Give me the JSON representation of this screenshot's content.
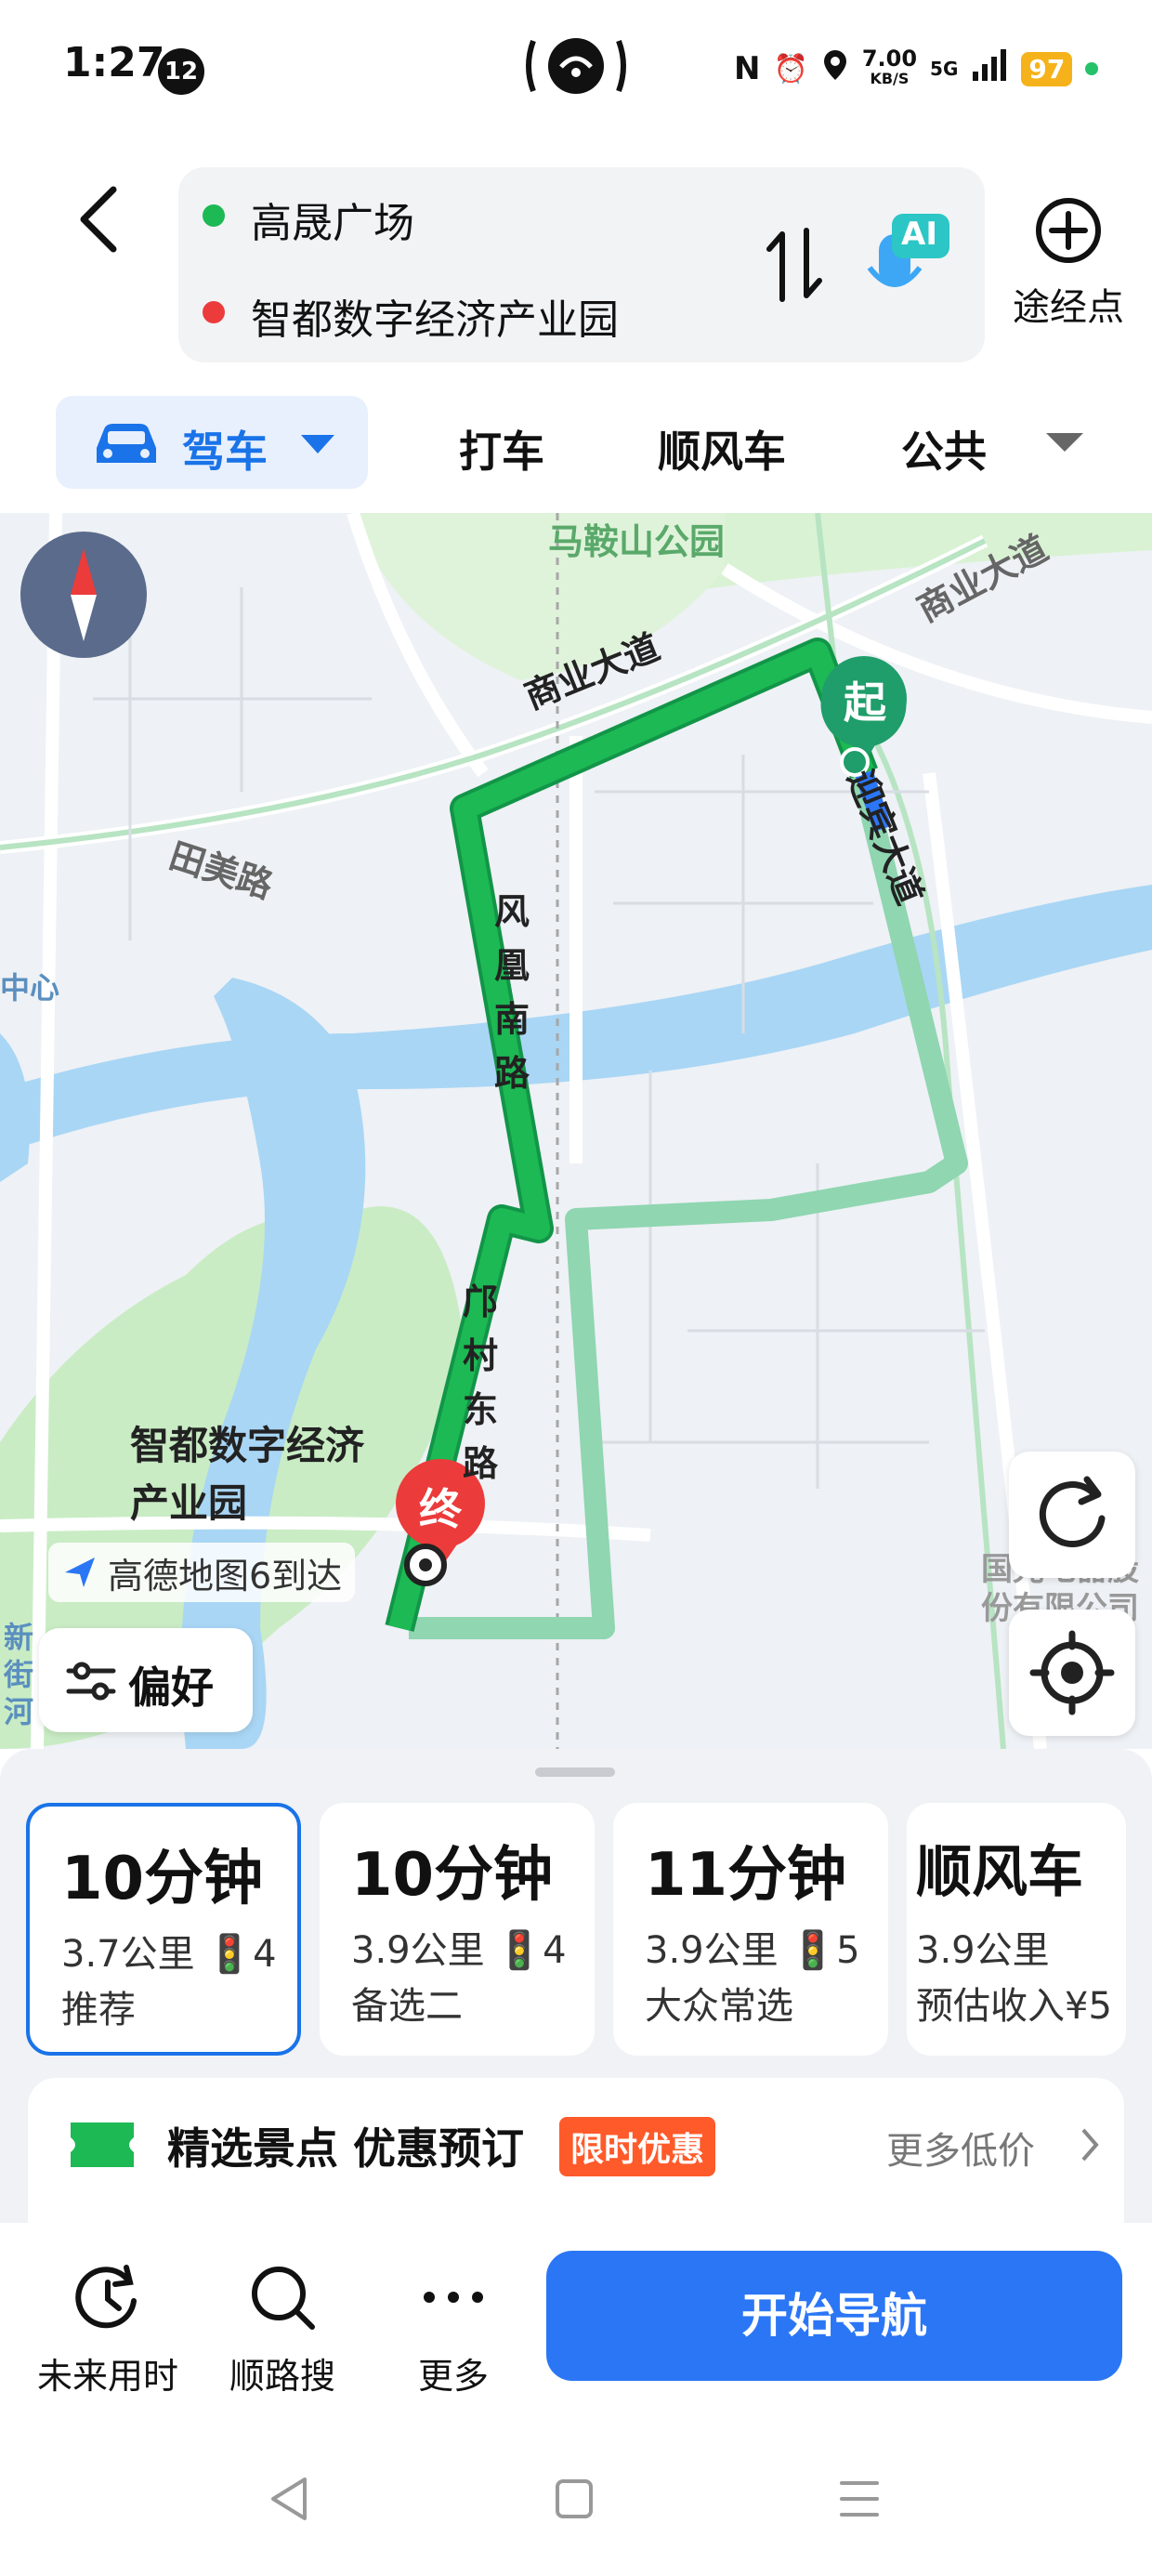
{
  "status_bar": {
    "time": "1:27",
    "notification_count": "12",
    "network_speed": "7.00",
    "network_speed_unit": "KB/S",
    "network_type": "5G",
    "battery": "97"
  },
  "header": {
    "origin": "高晟广场",
    "destination": "智都数字经济产业园",
    "ai_label": "AI",
    "waypoint_label": "途经点"
  },
  "mode_tabs": {
    "active": "驾车",
    "tabs": [
      "打车",
      "顺风车",
      "公共"
    ]
  },
  "map": {
    "park_label": "马鞍山公园",
    "road_labels": [
      "商业大道",
      "商业大道",
      "迎宾大道",
      "风凰南路",
      "邝村东路",
      "田美路",
      "新街河",
      "中心"
    ],
    "start_marker": "起",
    "end_marker": "终",
    "destination_label_line1": "智都数字经济",
    "destination_label_line2": "产业园",
    "poi_label": "国光电器股份有限公司",
    "amap_badge": "高德地图6到达",
    "preference_button": "偏好"
  },
  "routes": [
    {
      "time": "10分钟",
      "distance": "3.7公里",
      "lights": "4",
      "tag": "推荐",
      "selected": true
    },
    {
      "time": "10分钟",
      "distance": "3.9公里",
      "lights": "4",
      "tag": "备选二",
      "selected": false
    },
    {
      "time": "11分钟",
      "distance": "3.9公里",
      "lights": "5",
      "tag": "大众常选",
      "selected": false
    },
    {
      "time": "顺风车",
      "distance": "3.9公里",
      "lights": "",
      "tag": "预估收入¥5",
      "selected": false
    }
  ],
  "promo": {
    "title": "精选景点 优惠预订",
    "tag": "限时优惠",
    "more": "更多低价"
  },
  "actions": {
    "future_time": "未来用时",
    "along_search": "顺路搜",
    "more": "更多",
    "start_navigation": "开始导航"
  },
  "colors": {
    "accent": "#1a73e8",
    "route_green": "#1db954",
    "route_alt": "#8fd6b1",
    "start_marker": "#1f9d6a",
    "end_marker": "#ec3b3b",
    "promo_tag": "#ff5a2a"
  }
}
